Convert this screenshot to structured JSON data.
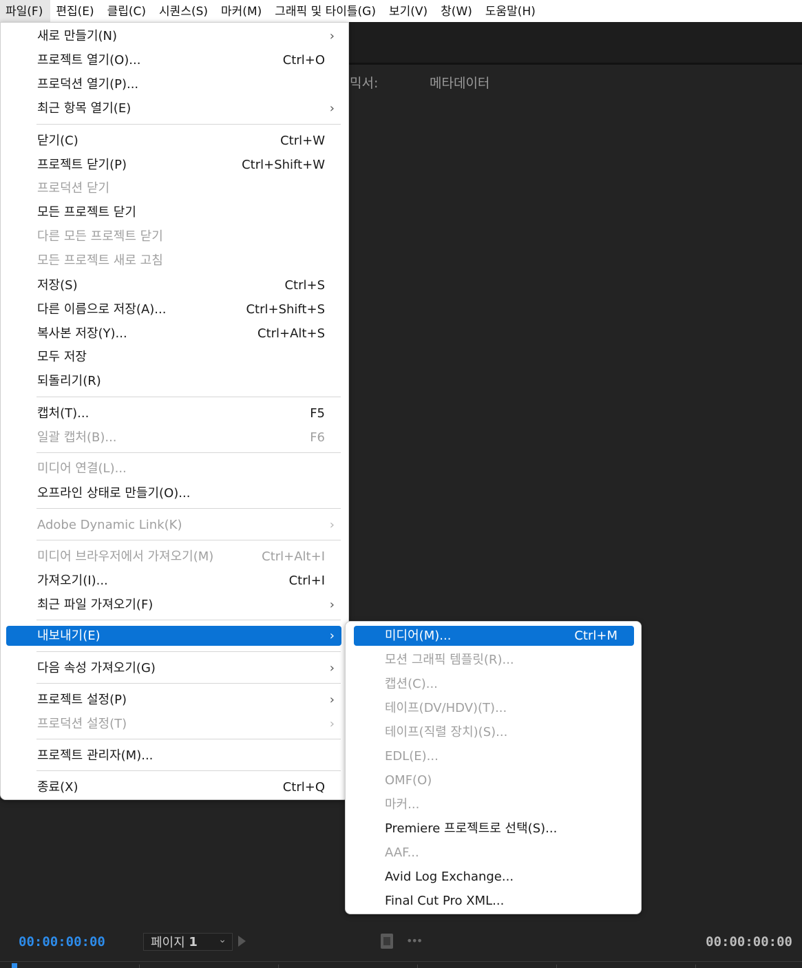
{
  "menubar": {
    "items": [
      "파일(F)",
      "편집(E)",
      "클립(C)",
      "시퀀스(S)",
      "마커(M)",
      "그래픽 및 타이틀(G)",
      "보기(V)",
      "창(W)",
      "도움말(H)"
    ]
  },
  "workspace": {
    "tab_mixer": "믹서:",
    "tab_metadata": "메타데이터"
  },
  "bottom_bar": {
    "timecode_left": "00:00:00:00",
    "page_label": "페이지",
    "page_value": "1",
    "timecode_right": "00:00:00:00"
  },
  "file_menu": {
    "items": [
      {
        "label": "새로 만들기(N)",
        "shortcut": "",
        "submenu": true,
        "disabled": false
      },
      {
        "label": "프로젝트 열기(O)...",
        "shortcut": "Ctrl+O",
        "submenu": false,
        "disabled": false
      },
      {
        "label": "프로덕션 열기(P)...",
        "shortcut": "",
        "submenu": false,
        "disabled": false
      },
      {
        "label": "최근 항목 열기(E)",
        "shortcut": "",
        "submenu": true,
        "disabled": false
      },
      {
        "label": "닫기(C)",
        "shortcut": "Ctrl+W",
        "submenu": false,
        "disabled": false
      },
      {
        "label": "프로젝트 닫기(P)",
        "shortcut": "Ctrl+Shift+W",
        "submenu": false,
        "disabled": false
      },
      {
        "label": "프로덕션 닫기",
        "shortcut": "",
        "submenu": false,
        "disabled": true
      },
      {
        "label": "모든 프로젝트 닫기",
        "shortcut": "",
        "submenu": false,
        "disabled": false
      },
      {
        "label": "다른 모든 프로젝트 닫기",
        "shortcut": "",
        "submenu": false,
        "disabled": true
      },
      {
        "label": "모든 프로젝트 새로 고침",
        "shortcut": "",
        "submenu": false,
        "disabled": true
      },
      {
        "label": "저장(S)",
        "shortcut": "Ctrl+S",
        "submenu": false,
        "disabled": false
      },
      {
        "label": "다른 이름으로 저장(A)...",
        "shortcut": "Ctrl+Shift+S",
        "submenu": false,
        "disabled": false
      },
      {
        "label": "복사본 저장(Y)...",
        "shortcut": "Ctrl+Alt+S",
        "submenu": false,
        "disabled": false
      },
      {
        "label": "모두 저장",
        "shortcut": "",
        "submenu": false,
        "disabled": false
      },
      {
        "label": "되돌리기(R)",
        "shortcut": "",
        "submenu": false,
        "disabled": false
      },
      {
        "label": "캡처(T)...",
        "shortcut": "F5",
        "submenu": false,
        "disabled": false
      },
      {
        "label": "일괄 캡처(B)...",
        "shortcut": "F6",
        "submenu": false,
        "disabled": true
      },
      {
        "label": "미디어 연결(L)...",
        "shortcut": "",
        "submenu": false,
        "disabled": true
      },
      {
        "label": "오프라인 상태로 만들기(O)...",
        "shortcut": "",
        "submenu": false,
        "disabled": false
      },
      {
        "label": "Adobe Dynamic Link(K)",
        "shortcut": "",
        "submenu": true,
        "disabled": true
      },
      {
        "label": "미디어 브라우저에서 가져오기(M)",
        "shortcut": "Ctrl+Alt+I",
        "submenu": false,
        "disabled": true
      },
      {
        "label": "가져오기(I)...",
        "shortcut": "Ctrl+I",
        "submenu": false,
        "disabled": false
      },
      {
        "label": "최근 파일 가져오기(F)",
        "shortcut": "",
        "submenu": true,
        "disabled": false
      },
      {
        "label": "내보내기(E)",
        "shortcut": "",
        "submenu": true,
        "disabled": false,
        "selected": true
      },
      {
        "label": "다음 속성 가져오기(G)",
        "shortcut": "",
        "submenu": true,
        "disabled": false
      },
      {
        "label": "프로젝트 설정(P)",
        "shortcut": "",
        "submenu": true,
        "disabled": false
      },
      {
        "label": "프로덕션 설정(T)",
        "shortcut": "",
        "submenu": true,
        "disabled": true
      },
      {
        "label": "프로젝트 관리자(M)...",
        "shortcut": "",
        "submenu": false,
        "disabled": false
      },
      {
        "label": "종료(X)",
        "shortcut": "Ctrl+Q",
        "submenu": false,
        "disabled": false
      }
    ]
  },
  "export_menu": {
    "items": [
      {
        "label": "미디어(M)...",
        "shortcut": "Ctrl+M",
        "disabled": false,
        "selected": true
      },
      {
        "label": "모션 그래픽 템플릿(R)...",
        "shortcut": "",
        "disabled": true
      },
      {
        "label": "캡션(C)...",
        "shortcut": "",
        "disabled": true
      },
      {
        "label": "테이프(DV/HDV)(T)...",
        "shortcut": "",
        "disabled": true
      },
      {
        "label": "테이프(직렬 장치)(S)...",
        "shortcut": "",
        "disabled": true
      },
      {
        "label": "EDL(E)...",
        "shortcut": "",
        "disabled": true
      },
      {
        "label": "OMF(O)",
        "shortcut": "",
        "disabled": true
      },
      {
        "label": "마커...",
        "shortcut": "",
        "disabled": true
      },
      {
        "label": "Premiere 프로젝트로 선택(S)...",
        "shortcut": "",
        "disabled": false
      },
      {
        "label": "AAF...",
        "shortcut": "",
        "disabled": true
      },
      {
        "label": "Avid Log Exchange...",
        "shortcut": "",
        "disabled": false
      },
      {
        "label": "Final Cut Pro XML...",
        "shortcut": "",
        "disabled": false
      }
    ]
  },
  "colors": {
    "accent": "#0a73d6",
    "timecode_blue": "#2d8ceb",
    "workspace_bg": "#232323"
  }
}
